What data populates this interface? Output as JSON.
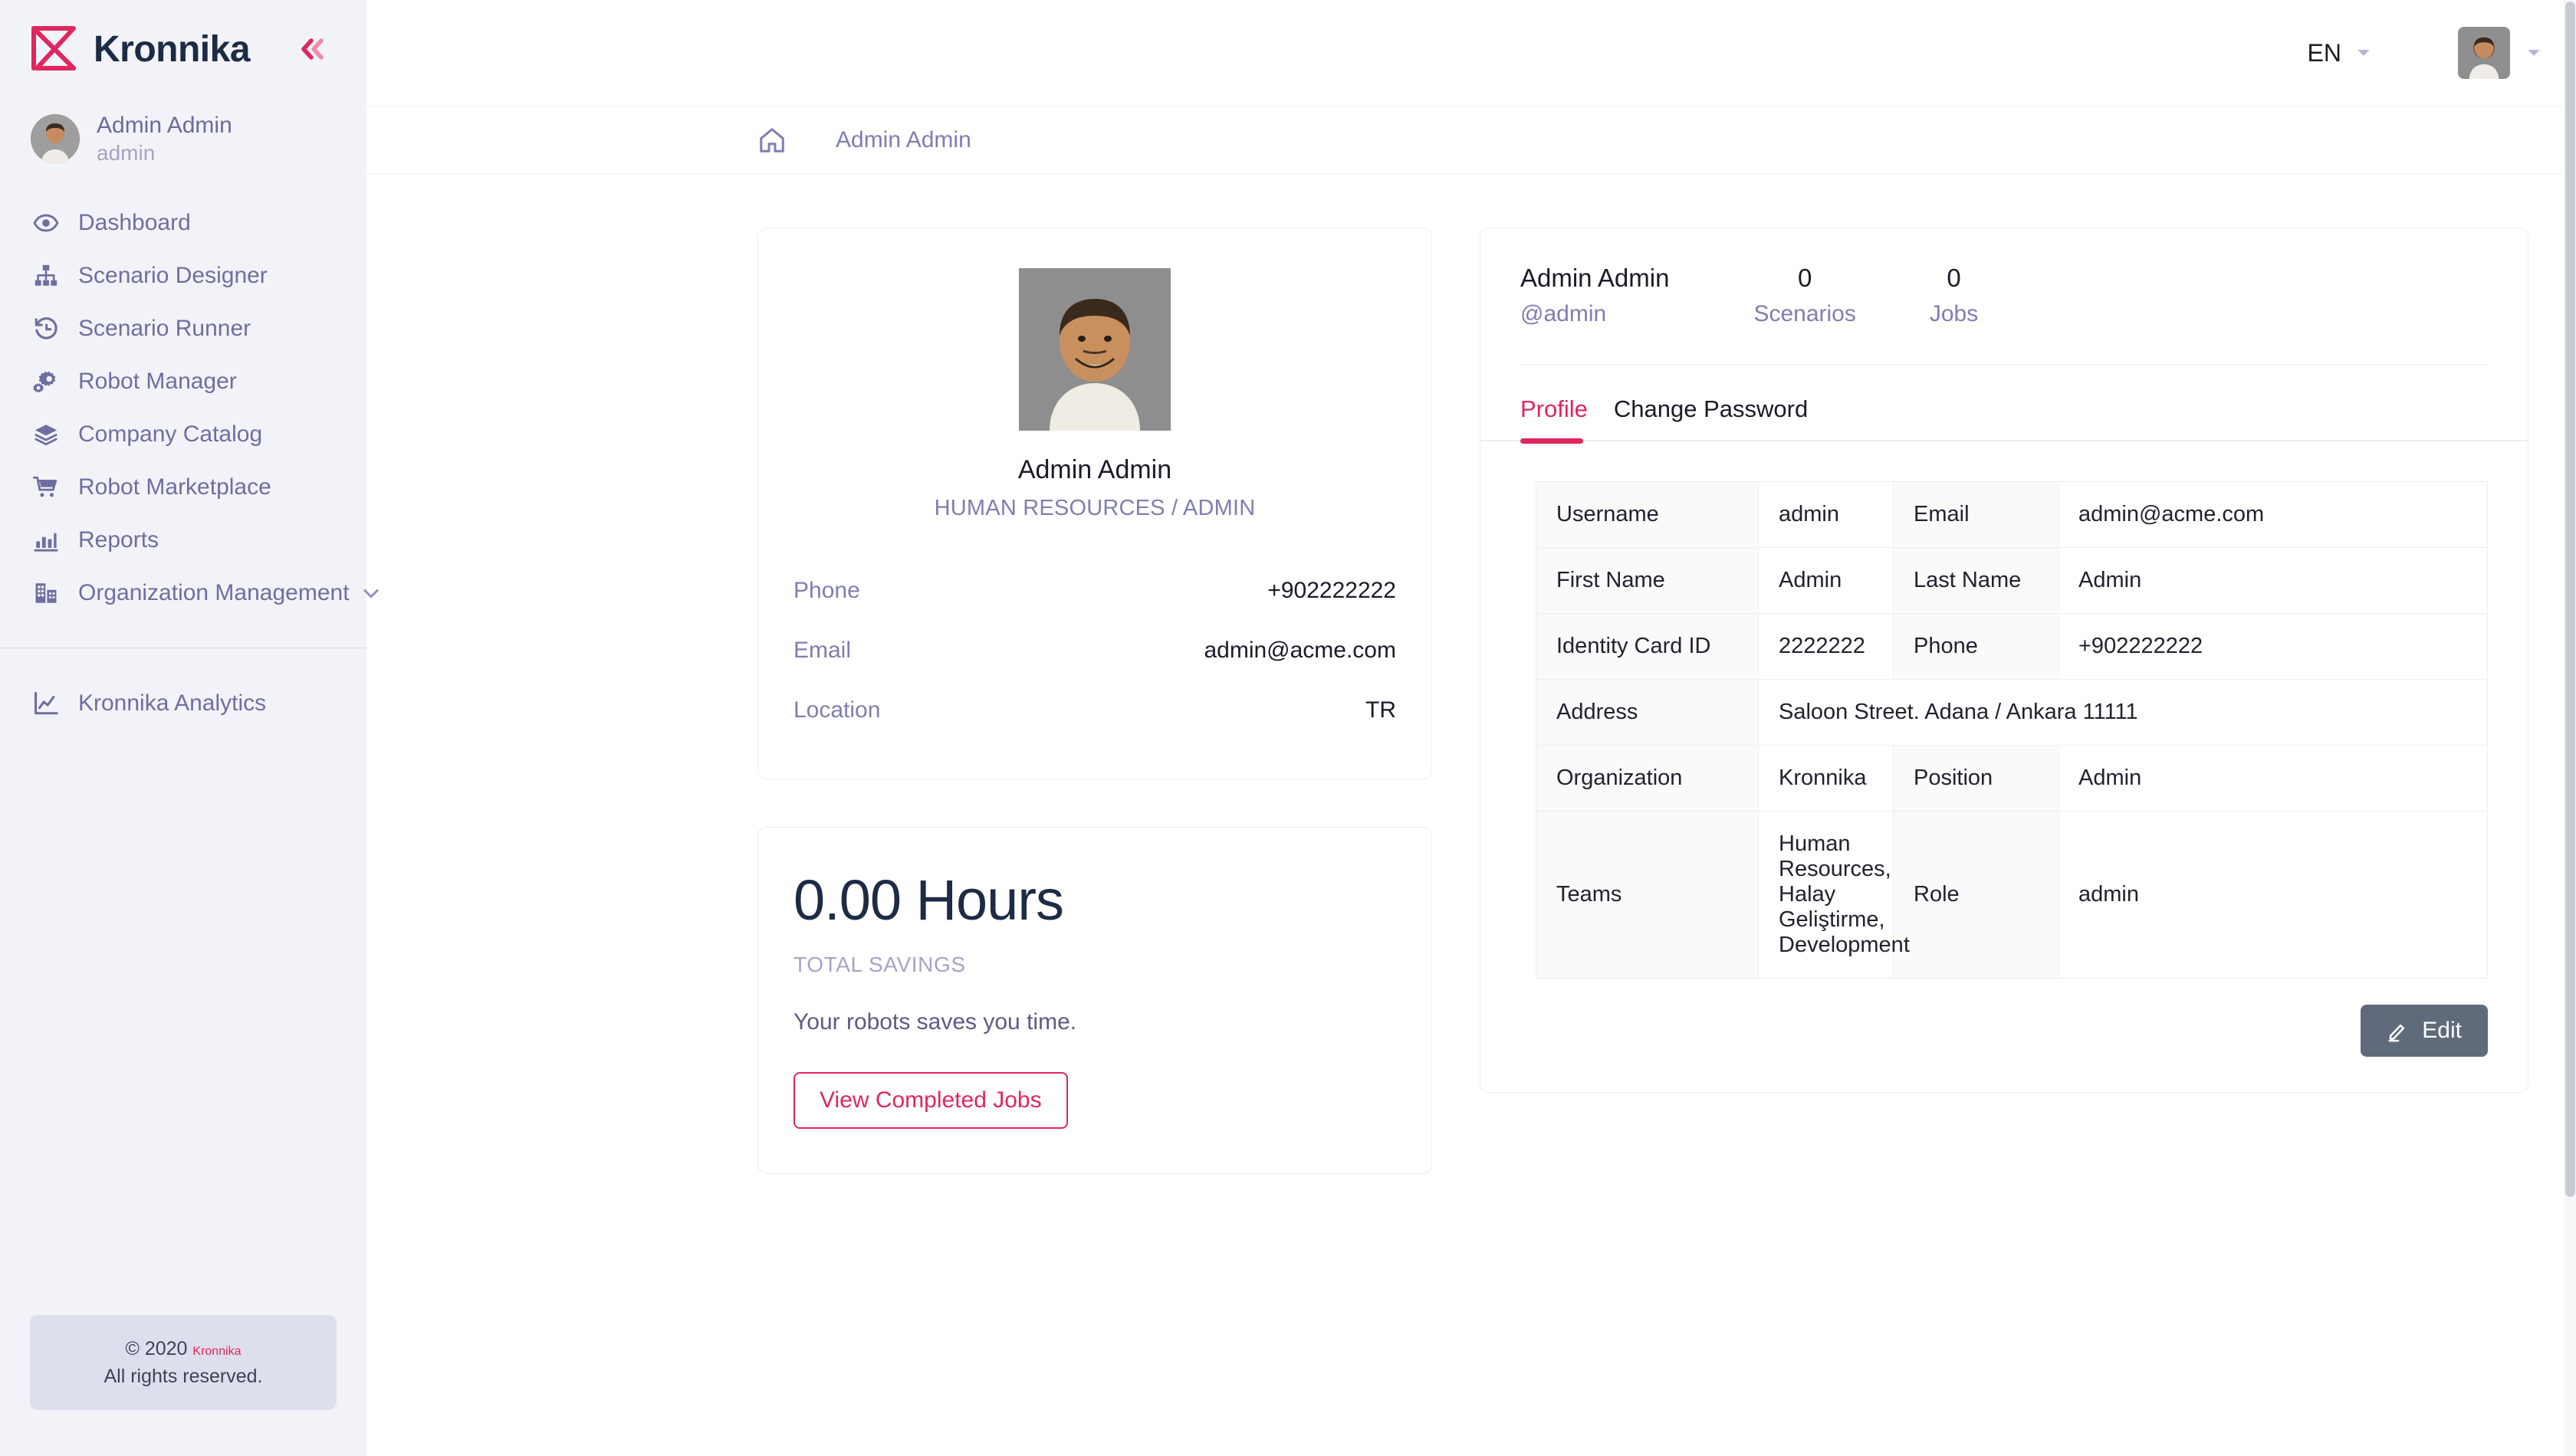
{
  "brand": {
    "name": "Kronnika",
    "logo_icon": "kronnika-logo-icon",
    "collapse_icon": "double-chevron-left-icon",
    "accent_pink": "#e0265e",
    "sidebar_bg": "#f2f3f8",
    "nav_text": "#6f6ea0"
  },
  "sidebar_user": {
    "name": "Admin Admin",
    "handle": "admin",
    "avatar_icon": "user-avatar"
  },
  "nav": {
    "items": [
      {
        "label": "Dashboard",
        "icon": "eye-icon",
        "has_caret": false
      },
      {
        "label": "Scenario Designer",
        "icon": "org-chart-icon",
        "has_caret": false
      },
      {
        "label": "Scenario Runner",
        "icon": "clock-rewind-icon",
        "has_caret": false
      },
      {
        "label": "Robot Manager",
        "icon": "gears-icon",
        "has_caret": false
      },
      {
        "label": "Company Catalog",
        "icon": "layers-icon",
        "has_caret": false
      },
      {
        "label": "Robot Marketplace",
        "icon": "shopping-cart-icon",
        "has_caret": false
      },
      {
        "label": "Reports",
        "icon": "bar-chart-icon",
        "has_caret": false
      },
      {
        "label": "Organization Management",
        "icon": "building-icon",
        "has_caret": true
      }
    ],
    "lower_items": [
      {
        "label": "Kronnika Analytics",
        "icon": "line-chart-icon",
        "has_caret": false
      }
    ]
  },
  "footer": {
    "copyright_prefix": "© 2020 ",
    "brand_link": "Kronnika",
    "rights": "All rights reserved."
  },
  "topbar": {
    "language": "EN",
    "language_caret_icon": "caret-down-icon",
    "avatar_icon": "user-avatar",
    "avatar_caret_icon": "caret-down-icon"
  },
  "breadcrumb": {
    "home_icon": "home-icon",
    "current": "Admin Admin"
  },
  "profile_card": {
    "photo_icon": "profile-photo",
    "name": "Admin Admin",
    "role": "HUMAN RESOURCES / ADMIN",
    "rows": [
      {
        "label": "Phone",
        "value": "+902222222"
      },
      {
        "label": "Email",
        "value": "admin@acme.com"
      },
      {
        "label": "Location",
        "value": "TR"
      }
    ]
  },
  "savings_card": {
    "hours": "0.00 Hours",
    "caption": "TOTAL SAVINGS",
    "description": "Your robots saves you time.",
    "button": "View Completed Jobs"
  },
  "detail": {
    "name": "Admin Admin",
    "handle": "@admin",
    "stats": [
      {
        "value": "0",
        "label": "Scenarios"
      },
      {
        "value": "0",
        "label": "Jobs"
      }
    ],
    "tabs": [
      {
        "label": "Profile",
        "active": true
      },
      {
        "label": "Change Password",
        "active": false
      }
    ],
    "table": [
      {
        "label1": "Username",
        "value1": "admin",
        "label2": "Email",
        "value2": "admin@acme.com",
        "full": false
      },
      {
        "label1": "First Name",
        "value1": "Admin",
        "label2": "Last Name",
        "value2": "Admin",
        "full": false
      },
      {
        "label1": "Identity Card ID",
        "value1": "2222222",
        "label2": "Phone",
        "value2": "+902222222",
        "full": false
      },
      {
        "label1": "Address",
        "value1": "Saloon Street. Adana / Ankara 11111",
        "label2": "",
        "value2": "",
        "full": true
      },
      {
        "label1": "Organization",
        "value1": "Kronnika",
        "label2": "Position",
        "value2": "Admin",
        "full": false
      },
      {
        "label1": "Teams",
        "value1": "Human Resources, Halay Geliştirme, Development",
        "label2": "Role",
        "value2": "admin",
        "full": false
      }
    ],
    "edit_button": "Edit",
    "edit_icon": "pencil-icon"
  }
}
